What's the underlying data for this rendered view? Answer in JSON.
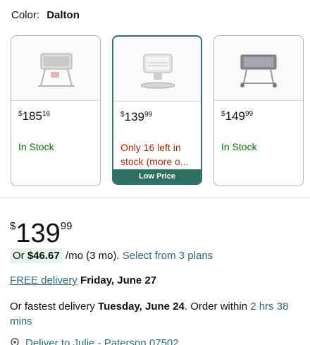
{
  "color": {
    "label": "Color:",
    "value": "Dalton"
  },
  "options": [
    {
      "price_whole": "185",
      "price_cents": "16",
      "currency": "$",
      "stock": "In Stock",
      "stock_status": "in_stock",
      "selected": false,
      "image_icon": "bassinet-image"
    },
    {
      "price_whole": "139",
      "price_cents": "99",
      "currency": "$",
      "stock": "Only 16 left in stock (more o...",
      "stock_status": "low",
      "selected": true,
      "badge": "Low Price",
      "image_icon": "bassinet-image"
    },
    {
      "price_whole": "149",
      "price_cents": "99",
      "currency": "$",
      "stock": "In Stock",
      "stock_status": "in_stock",
      "selected": false,
      "image_icon": "bassinet-image"
    }
  ],
  "price": {
    "currency": "$",
    "whole": "139",
    "cents": "99"
  },
  "installment": {
    "prefix": "Or",
    "amount": "$46.67",
    "term": "/mo (3 mo).",
    "link": "Select from 3 plans"
  },
  "delivery": {
    "free_link": "FREE delivery",
    "date": "Friday, June 27"
  },
  "fastest": {
    "prefix": "Or fastest delivery",
    "date": "Tuesday, June 24",
    "middle": ". Order within",
    "countdown": "2 hrs 38 mins"
  },
  "deliver_to": {
    "text": "Deliver to Julie - Paterson 07502"
  },
  "colors": {
    "accent_teal": "#2a6b76",
    "in_stock_green": "#007600",
    "low_stock_red": "#b12704",
    "badge_green": "#2f7160",
    "installment_bg": "#e3f4e9"
  }
}
